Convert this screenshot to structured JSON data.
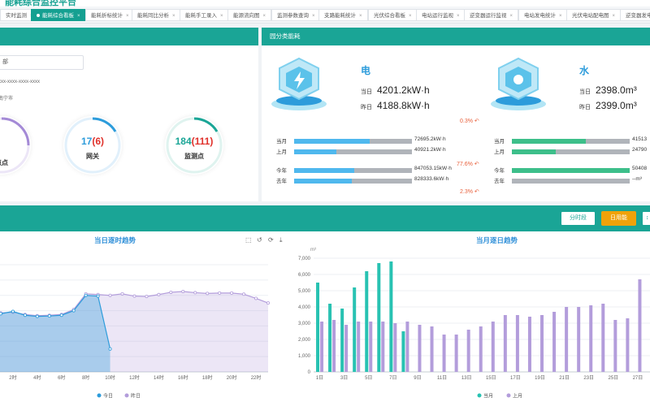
{
  "header": {
    "title": "能耗综合监控平台"
  },
  "tabs": [
    {
      "label": "实时监测",
      "x": 0
    },
    {
      "label": "能耗综合看板",
      "x": 38,
      "active": true
    },
    {
      "label": "能耗折标统计",
      "x": 105
    },
    {
      "label": "能耗同比分析",
      "x": 162
    },
    {
      "label": "能耗手工录入",
      "x": 221
    },
    {
      "label": "能源流向图",
      "x": 280
    },
    {
      "label": "监测参数查询",
      "x": 334
    },
    {
      "label": "支路能耗统计",
      "x": 392
    },
    {
      "label": "光伏综合看板",
      "x": 453
    },
    {
      "label": "电站运行监视",
      "x": 512
    },
    {
      "label": "逆变器运行监视",
      "x": 571
    },
    {
      "label": "电站发电统计",
      "x": 638
    },
    {
      "label": "光伏电站配电图",
      "x": 697
    },
    {
      "label": "逆变器发电",
      "x": 763
    }
  ],
  "left_panel": {
    "input_value": "部",
    "info_id": "xxx-xxxx-xxxx-xxxx",
    "info_city": "南宁市",
    "stats": [
      {
        "value": "",
        "sub": "",
        "label": "点点",
        "color": "#a48ad6"
      },
      {
        "value": "17",
        "sub": "(6)",
        "label": "网关",
        "color": "#2d9cdb"
      },
      {
        "value": "184",
        "sub": "(111)",
        "label": "监测点",
        "color": "#1aa596"
      }
    ]
  },
  "category_panel": {
    "title": "园分类能耗",
    "electric": {
      "name": "电",
      "today_label": "当日",
      "today_value": "4201.2kW·h",
      "yesterday_label": "昨日",
      "yesterday_value": "4188.8kW·h",
      "day_pct": "0.3%",
      "month_label": "当月",
      "month_value": "72695.2kW·h",
      "lastmonth_label": "上月",
      "lastmonth_value": "40921.2kW·h",
      "month_pct": "77.6%",
      "year_label": "今年",
      "year_value": "847053.15kW·h",
      "lastyear_label": "去年",
      "lastyear_value": "828333.6kW·h",
      "year_pct": "2.3%",
      "month_ratio": 0.64,
      "lastmonth_ratio": 0.36,
      "year_ratio": 0.51,
      "lastyear_ratio": 0.49
    },
    "water": {
      "name": "水",
      "today_label": "当日",
      "today_value": "2398.0m³",
      "yesterday_label": "昨日",
      "yesterday_value": "2399.0m³",
      "month_label": "当月",
      "month_value": "41513",
      "lastmonth_label": "上月",
      "lastmonth_value": "24790",
      "year_label": "今年",
      "year_value": "50408",
      "lastyear_label": "去年",
      "lastyear_value": "--m³",
      "month_ratio": 0.63,
      "lastmonth_ratio": 0.37,
      "year_ratio": 1.0,
      "lastyear_ratio": 0
    }
  },
  "trend_panel": {
    "buttons": [
      "分时段",
      "日用能"
    ],
    "active_button": "日用能"
  },
  "colors": {
    "accent": "#1aa596",
    "blue": "#2d9cdb",
    "purple": "#b39ddb",
    "orange": "#f0a20a",
    "red": "#e0312b"
  },
  "chart_data": [
    {
      "type": "area",
      "title": "当日逐时趋势",
      "xlabel": "",
      "ylabel": "",
      "categories": [
        "0时",
        "1时",
        "2时",
        "3时",
        "4时",
        "5时",
        "6时",
        "7时",
        "8时",
        "9时",
        "10时",
        "11时",
        "12时",
        "13时",
        "14时",
        "15时",
        "16时",
        "17时",
        "18时",
        "19时",
        "20时",
        "21时",
        "22时",
        "23时"
      ],
      "tick_labels": [
        "0时",
        "2时",
        "4时",
        "6时",
        "8时",
        "10时",
        "12时",
        "14时",
        "16时",
        "18时",
        "20时",
        "22时"
      ],
      "series": [
        {
          "name": "今日",
          "color": "#2d9cdb",
          "values": [
            150,
            152,
            158,
            148,
            145,
            146,
            148,
            160,
            200,
            198,
            60,
            null,
            null,
            null,
            null,
            null,
            null,
            null,
            null,
            null,
            null,
            null,
            null,
            null
          ]
        },
        {
          "name": "昨日",
          "color": "#b39ddb",
          "values": [
            152,
            154,
            156,
            150,
            147,
            148,
            150,
            163,
            204,
            202,
            200,
            204,
            198,
            197,
            202,
            208,
            210,
            207,
            205,
            206,
            206,
            203,
            192,
            180
          ]
        }
      ],
      "ylim": [
        0,
        280
      ],
      "legend": "bottom"
    },
    {
      "type": "bar",
      "title": "当月逐日趋势",
      "ylabel": "m³",
      "ylim": [
        0,
        7000
      ],
      "yticks": [
        "0",
        "1,000",
        "2,000",
        "3,000",
        "4,000",
        "5,000",
        "6,000",
        "7,000"
      ],
      "categories": [
        "1日",
        "2日",
        "3日",
        "4日",
        "5日",
        "6日",
        "7日",
        "8日",
        "9日",
        "10日",
        "11日",
        "12日",
        "13日",
        "14日",
        "15日",
        "16日",
        "17日",
        "18日",
        "19日",
        "20日",
        "21日",
        "22日",
        "23日",
        "24日",
        "25日",
        "26日",
        "27日",
        "28日"
      ],
      "tick_labels": [
        "1日",
        "3日",
        "5日",
        "7日",
        "9日",
        "11日",
        "13日",
        "15日",
        "17日",
        "19日",
        "21日",
        "23日",
        "25日",
        "27日"
      ],
      "series": [
        {
          "name": "当月",
          "color": "#28c2b2",
          "values": [
            5500,
            4200,
            3900,
            5200,
            6200,
            6700,
            6800,
            2500,
            null,
            null,
            null,
            null,
            null,
            null,
            null,
            null,
            null,
            null,
            null,
            null,
            null,
            null,
            null,
            null,
            null,
            null,
            null,
            null
          ]
        },
        {
          "name": "上月",
          "color": "#b39ddb",
          "values": [
            3100,
            3200,
            2900,
            3100,
            3100,
            3100,
            3000,
            3100,
            2900,
            2800,
            2300,
            2300,
            2600,
            2800,
            3100,
            3500,
            3500,
            3400,
            3500,
            3700,
            4000,
            4000,
            4100,
            4200,
            3200,
            3300,
            5700,
            5700
          ]
        }
      ],
      "legend": "bottom"
    }
  ]
}
